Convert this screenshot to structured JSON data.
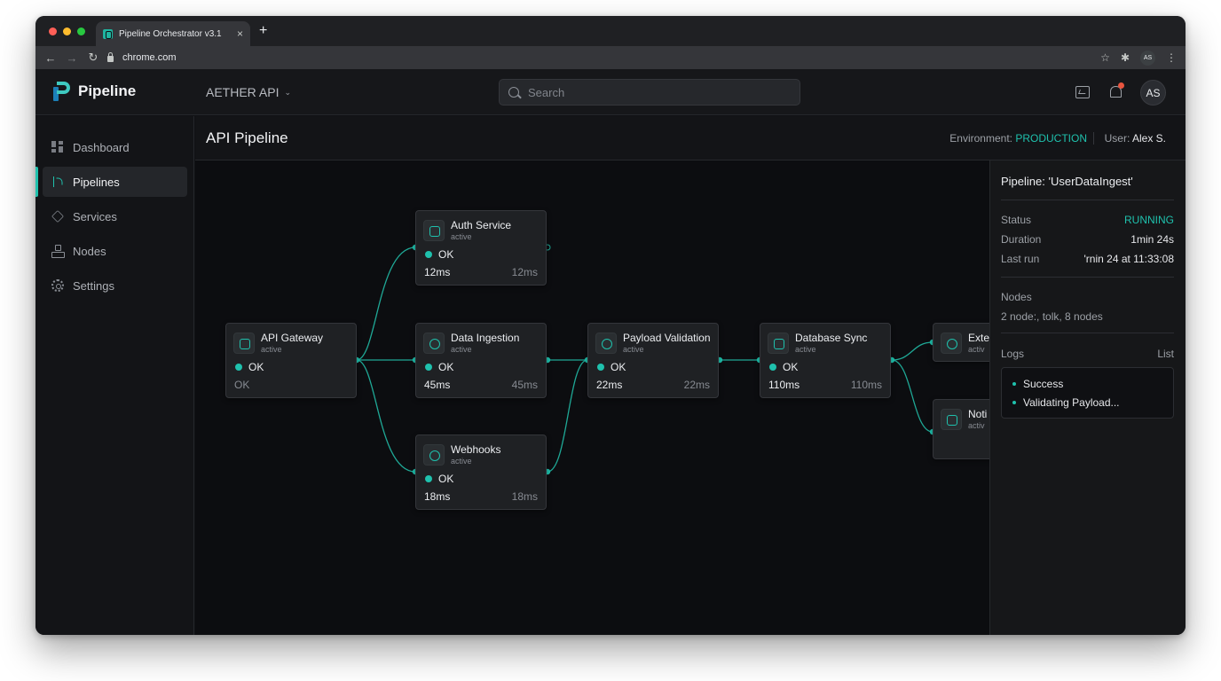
{
  "browser": {
    "tab_title": "Pipeline Orchestrator v3.1",
    "tab_close": "×",
    "new_tab": "+",
    "url": "chrome.com",
    "back": "←",
    "forward": "→",
    "reload": "↻",
    "star": "☆",
    "extensions": "✱",
    "profile": "AS",
    "menu": "⋮"
  },
  "header": {
    "app_name": "Pipeline",
    "project": "AETHER API",
    "project_chevron": "⌄",
    "search_placeholder": "Search",
    "notification_count": "",
    "user_initials": "AS"
  },
  "sidebar": {
    "items": [
      {
        "label": "Dashboard",
        "icon": "grid-icon"
      },
      {
        "label": "Pipelines",
        "icon": "branch-icon",
        "active": true
      },
      {
        "label": "Services",
        "icon": "layers-icon"
      },
      {
        "label": "Nodes",
        "icon": "nodes-icon"
      },
      {
        "label": "Settings",
        "icon": "gear-icon"
      }
    ]
  },
  "main": {
    "title": "API Pipeline",
    "environment_label": "Environment: ",
    "environment_value": "PRODUCTION",
    "user_label": "User: ",
    "user_value": "Alex S."
  },
  "nodes": {
    "gateway": {
      "title": "API Gateway",
      "sub": "active",
      "status": "OK",
      "left": "OK",
      "right": ""
    },
    "auth": {
      "title": "Auth Service",
      "sub": "active",
      "status": "OK",
      "left": "12ms",
      "right": "12ms"
    },
    "ingest": {
      "title": "Data Ingestion",
      "sub": "active",
      "status": "OK",
      "left": "45ms",
      "right": "45ms"
    },
    "webhooks": {
      "title": "Webhooks",
      "sub": "active",
      "status": "OK",
      "left": "18ms",
      "right": "18ms"
    },
    "validation": {
      "title": "Payload Validation",
      "sub": "active",
      "status": "OK",
      "left": "22ms",
      "right": "22ms"
    },
    "dbsync": {
      "title": "Database Sync",
      "sub": "active",
      "status": "OK",
      "left": "110ms",
      "right": "110ms"
    },
    "external": {
      "title": "Exte",
      "sub": "activ"
    },
    "notify": {
      "title": "Noti",
      "sub": "activ"
    }
  },
  "panel": {
    "title": "Pipeline: 'UserDataIngest'",
    "status_label": "Status",
    "status_value": "RUNNING",
    "duration_label": "Duration",
    "duration_value": "1min 24s",
    "lastrun_label": "Last run",
    "lastrun_value": "'rnin 24 at 11:33:08",
    "nodes_label": "Nodes",
    "nodes_value": "2 node:, tolk, 8 nodes",
    "logs_label": "Logs",
    "logs_link": "List",
    "logs": [
      "Success",
      "Validating Payload..."
    ]
  },
  "colors": {
    "accent": "#1fc1ad",
    "background": "#0c0d10",
    "node_bg": "#1f2124"
  }
}
